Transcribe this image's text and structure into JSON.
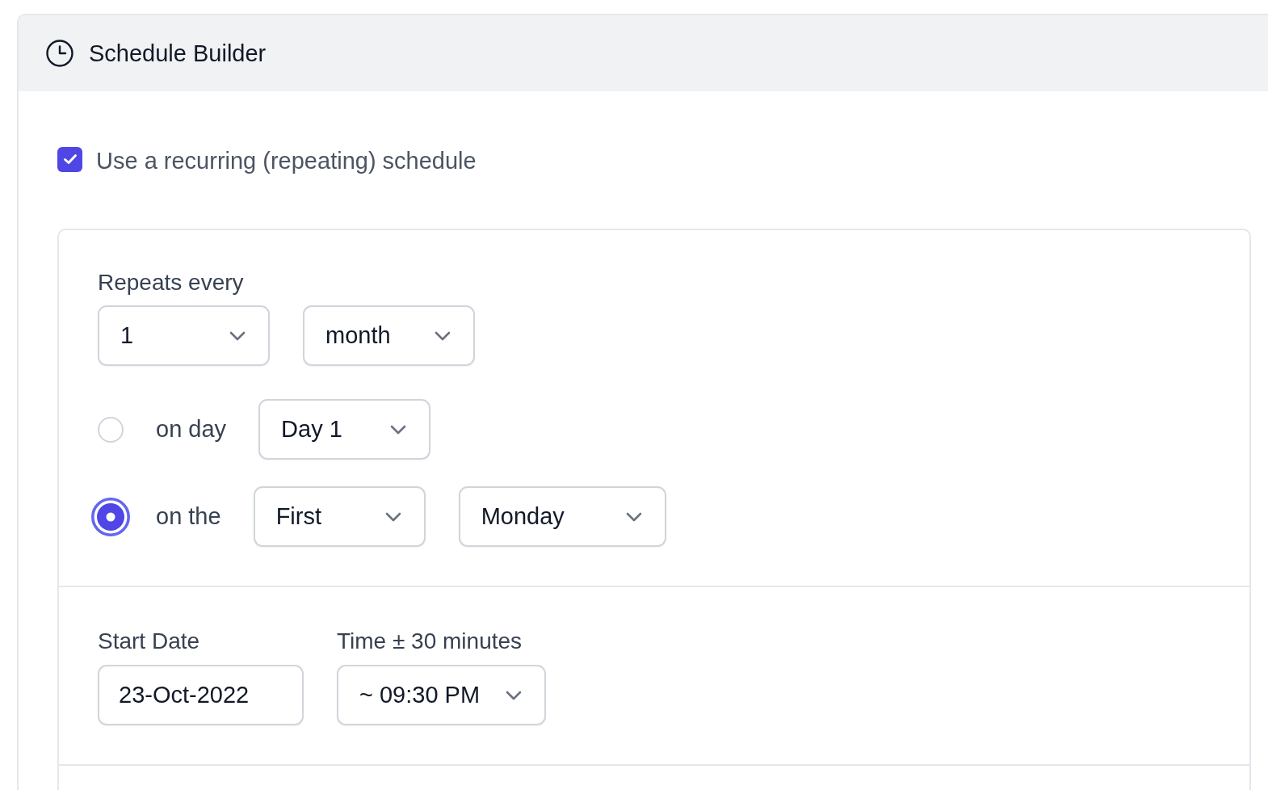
{
  "header": {
    "title": "Schedule Builder"
  },
  "recurring": {
    "label": "Use a recurring (repeating) schedule",
    "checked": true
  },
  "repeat": {
    "label": "Repeats every",
    "selects": [
      {
        "value": "1"
      },
      {
        "value": "month"
      }
    ]
  },
  "options": [
    {
      "label": "on day",
      "selected": false,
      "selects": [
        {
          "value": "Day 1"
        }
      ]
    },
    {
      "label": "on the",
      "selected": true,
      "selects": [
        {
          "value": "First"
        },
        {
          "value": "Monday"
        }
      ]
    }
  ],
  "start_date": {
    "label": "Start Date",
    "value": "23-Oct-2022"
  },
  "time": {
    "label": "Time ± 30 minutes",
    "value": "~ 09:30 PM"
  }
}
